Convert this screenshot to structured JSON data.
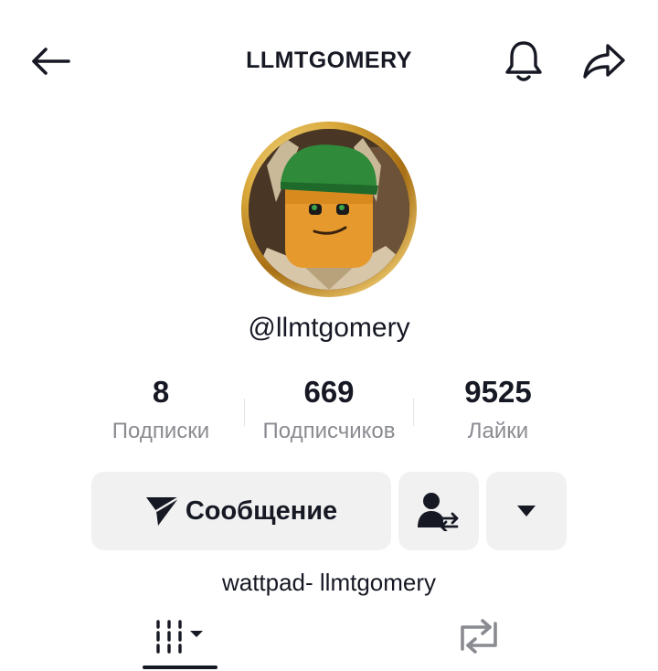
{
  "header": {
    "title": "LLMTGOMERY",
    "back_icon": "arrow-left-icon",
    "bell_icon": "bell-icon",
    "share_icon": "share-arrow-icon"
  },
  "profile": {
    "avatar_icon": "lego-minifigure-avatar",
    "avatar_ring_color": "#d4a43a",
    "handle": "@llmtgomery",
    "bio": "wattpad- llmtgomery"
  },
  "stats": [
    {
      "value": "8",
      "label": "Подписки"
    },
    {
      "value": "669",
      "label": "Подписчиков"
    },
    {
      "value": "9525",
      "label": "Лайки"
    }
  ],
  "actions": {
    "message_label": "Сообщение",
    "message_icon": "paper-plane-icon",
    "friend_icon": "person-swap-icon",
    "more_icon": "caret-down-icon"
  },
  "tabs": {
    "videos_icon": "grid-bars-icon",
    "reposts_icon": "repost-icon"
  },
  "colors": {
    "text": "#161823",
    "muted": "#8a8b91",
    "button_bg": "#f1f1f2"
  }
}
